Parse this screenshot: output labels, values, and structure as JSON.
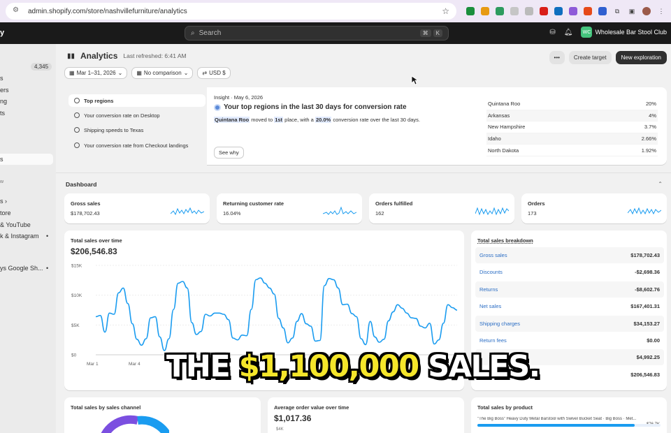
{
  "browser": {
    "url": "admin.shopify.com/store/nashvillefurniture/analytics"
  },
  "topbar": {
    "search_placeholder": "Search",
    "shortcut_keys": [
      "⌘",
      "K"
    ],
    "store_initials": "WC",
    "store_name": "Wholesale Bar Stool Club"
  },
  "sidebar": {
    "badge": "4,345",
    "items": [
      "s",
      "ers",
      "ng",
      "ts",
      "s",
      "w",
      "s ›",
      "tore",
      "& YouTube",
      "k & Instagram",
      "ys Google Sh..."
    ],
    "active_index": 4
  },
  "header": {
    "title": "Analytics",
    "refreshed": "Last refreshed: 6:41 AM",
    "create_target": "Create target",
    "new_exploration": "New exploration"
  },
  "filters": {
    "date": "Mar 1–31, 2026",
    "comparison": "No comparison",
    "currency": "USD $"
  },
  "insights": {
    "list": [
      "Top regions",
      "Your conversion rate on Desktop",
      "Shipping speeds to Texas",
      "Your conversion rate from Checkout landings"
    ],
    "date": "Insight · May 6, 2026",
    "title": "Your top regions in the last 30 days for conversion rate",
    "desc_region": "Quintana Roo",
    "desc_part1": "moved to",
    "desc_rank": "1st",
    "desc_part2": "place, with a",
    "desc_rate": "20.0%",
    "desc_part3": "conversion rate over the last 30 days.",
    "see_why": "See why",
    "regions": [
      {
        "name": "Quintana Roo",
        "value": "20%"
      },
      {
        "name": "Arkansas",
        "value": "4%"
      },
      {
        "name": "New Hampshire",
        "value": "3.7%"
      },
      {
        "name": "Idaho",
        "value": "2.66%"
      },
      {
        "name": "North Dakota",
        "value": "1.92%"
      }
    ]
  },
  "dashboard": {
    "title": "Dashboard",
    "kpis": [
      {
        "label": "Gross sales",
        "value": "$178,702.43"
      },
      {
        "label": "Returning customer rate",
        "value": "16.04%"
      },
      {
        "label": "Orders fulfilled",
        "value": "162"
      },
      {
        "label": "Orders",
        "value": "173"
      }
    ],
    "sales_over_time": {
      "title": "Total sales over time",
      "total": "$206,546.83",
      "y_ticks": [
        "$15K",
        "$10K",
        "$5K",
        "$0"
      ],
      "x_ticks": [
        "Mar 1",
        "Mar 4"
      ]
    },
    "breakdown": {
      "title": "Total sales breakdown",
      "rows": [
        {
          "label": "Gross sales",
          "value": "$178,702.43"
        },
        {
          "label": "Discounts",
          "value": "-$2,698.36"
        },
        {
          "label": "Returns",
          "value": "-$8,602.76"
        },
        {
          "label": "Net sales",
          "value": "$167,401.31"
        },
        {
          "label": "Shipping charges",
          "value": "$34,153.27"
        },
        {
          "label": "Return fees",
          "value": "$0.00"
        },
        {
          "label": "",
          "value": "$4,992.25"
        },
        {
          "label": "",
          "value": "$206,546.83"
        }
      ]
    },
    "by_channel": {
      "title": "Total sales by sales channel"
    },
    "aov": {
      "title": "Average order value over time",
      "value": "$1,017.36",
      "first_tick": "$4K"
    },
    "by_product": {
      "title": "Total sales by product",
      "top_name": "\"The Big Boss\" Heavy Duty Metal Barstool with Swivel Bucket Seat · Big Boss · Met...",
      "top_value": "$76.7K"
    }
  },
  "chart_data": {
    "type": "line",
    "title": "Total sales over time",
    "ylim": [
      0,
      15000
    ],
    "y_ticks": [
      "$15K",
      "$10K",
      "$5K",
      "$0"
    ],
    "x_ticks": [
      "Mar 1",
      "Mar 4"
    ],
    "series": [
      {
        "values": [
          6400,
          6600,
          3800,
          7000,
          6800,
          10400,
          11200,
          8600,
          5200,
          2600,
          1600,
          2700,
          6200,
          6400,
          3000,
          700,
          2700,
          7600,
          12000,
          12300,
          11200,
          5400,
          3400,
          3900,
          6800,
          6500,
          7000,
          7000,
          6800,
          5900,
          2800,
          2500,
          3300,
          3200,
          7600,
          12600,
          12900,
          12000,
          11200,
          10200,
          6100,
          4500,
          2000,
          2800,
          5600,
          6900,
          5200,
          4800,
          2300,
          2400,
          11600,
          12800,
          12600,
          11200,
          8400,
          8500,
          6900,
          6400,
          2700,
          1700,
          5600,
          3000,
          2100,
          2600,
          5700,
          7200,
          8400,
          7800,
          7000,
          6200,
          6100,
          4800,
          4500,
          5300,
          1800,
          2500,
          5300,
          8400,
          7900,
          7500
        ]
      }
    ],
    "grid": true,
    "color": "#1a9cf0"
  },
  "colors": {
    "accent": "#1a9cf0",
    "caption_highlight": "#f5e62a"
  },
  "caption": {
    "part1": "THE",
    "highlight": "$1,100,000",
    "part2": "SALES."
  }
}
